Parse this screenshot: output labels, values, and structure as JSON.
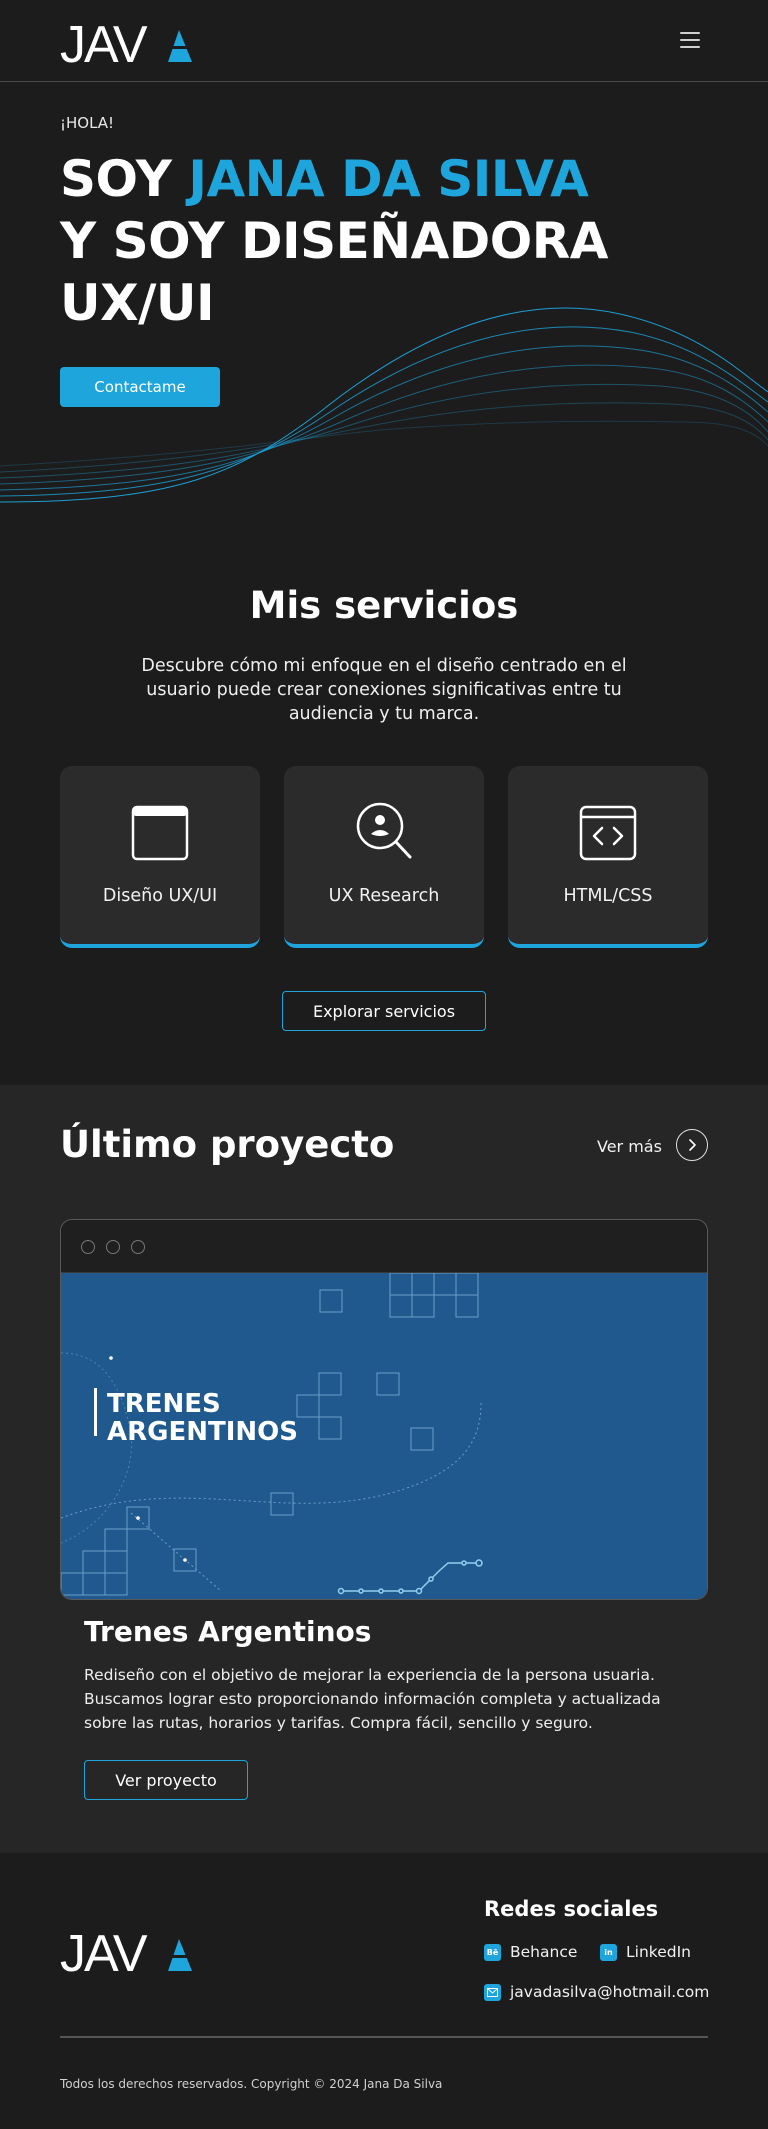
{
  "header": {
    "logo_text": "JAVA",
    "menu_icon": "hamburger-menu-icon"
  },
  "hero": {
    "greeting": "¡HOLA!",
    "title_prefix": "SOY ",
    "title_name": "JANA DA SILVA",
    "title_line2": "Y SOY DISEÑADORA",
    "title_line3": "UX/UI",
    "cta_label": "Contactame"
  },
  "services": {
    "title": "Mis servicios",
    "description": "Descubre cómo mi enfoque en el diseño centrado en el usuario puede crear conexiones significativas entre tu audiencia y tu marca.",
    "cards": [
      {
        "label": "Diseño UX/UI",
        "icon": "browser-window-icon"
      },
      {
        "label": "UX Research",
        "icon": "user-search-icon"
      },
      {
        "label": "HTML/CSS",
        "icon": "code-icon"
      }
    ],
    "explore_label": "Explorar servicios"
  },
  "project": {
    "title": "Último proyecto",
    "see_more": "Ver más",
    "thumbnail_title_line1": "TRENES",
    "thumbnail_title_line2": "ARGENTINOS",
    "name": "Trenes Argentinos",
    "description": "Rediseño con el objetivo de mejorar la experiencia de la persona usuaria. Buscamos lograr esto proporcionando información completa y actualizada sobre las rutas, horarios y tarifas. Compra fácil, sencillo y seguro.",
    "view_label": "Ver proyecto"
  },
  "footer": {
    "logo_text": "JAVA",
    "social_title": "Redes sociales",
    "links": {
      "behance": "Behance",
      "linkedin": "LinkedIn",
      "email": "javadasilva@hotmail.com"
    },
    "copyright": "Todos los derechos reservados. Copyright © 2024 Jana Da Silva"
  },
  "colors": {
    "accent": "#1ea5dc",
    "background": "#1c1c1c",
    "section_alt": "#262626",
    "card": "#2b2b2b",
    "thumbnail_blue": "#20598e"
  }
}
